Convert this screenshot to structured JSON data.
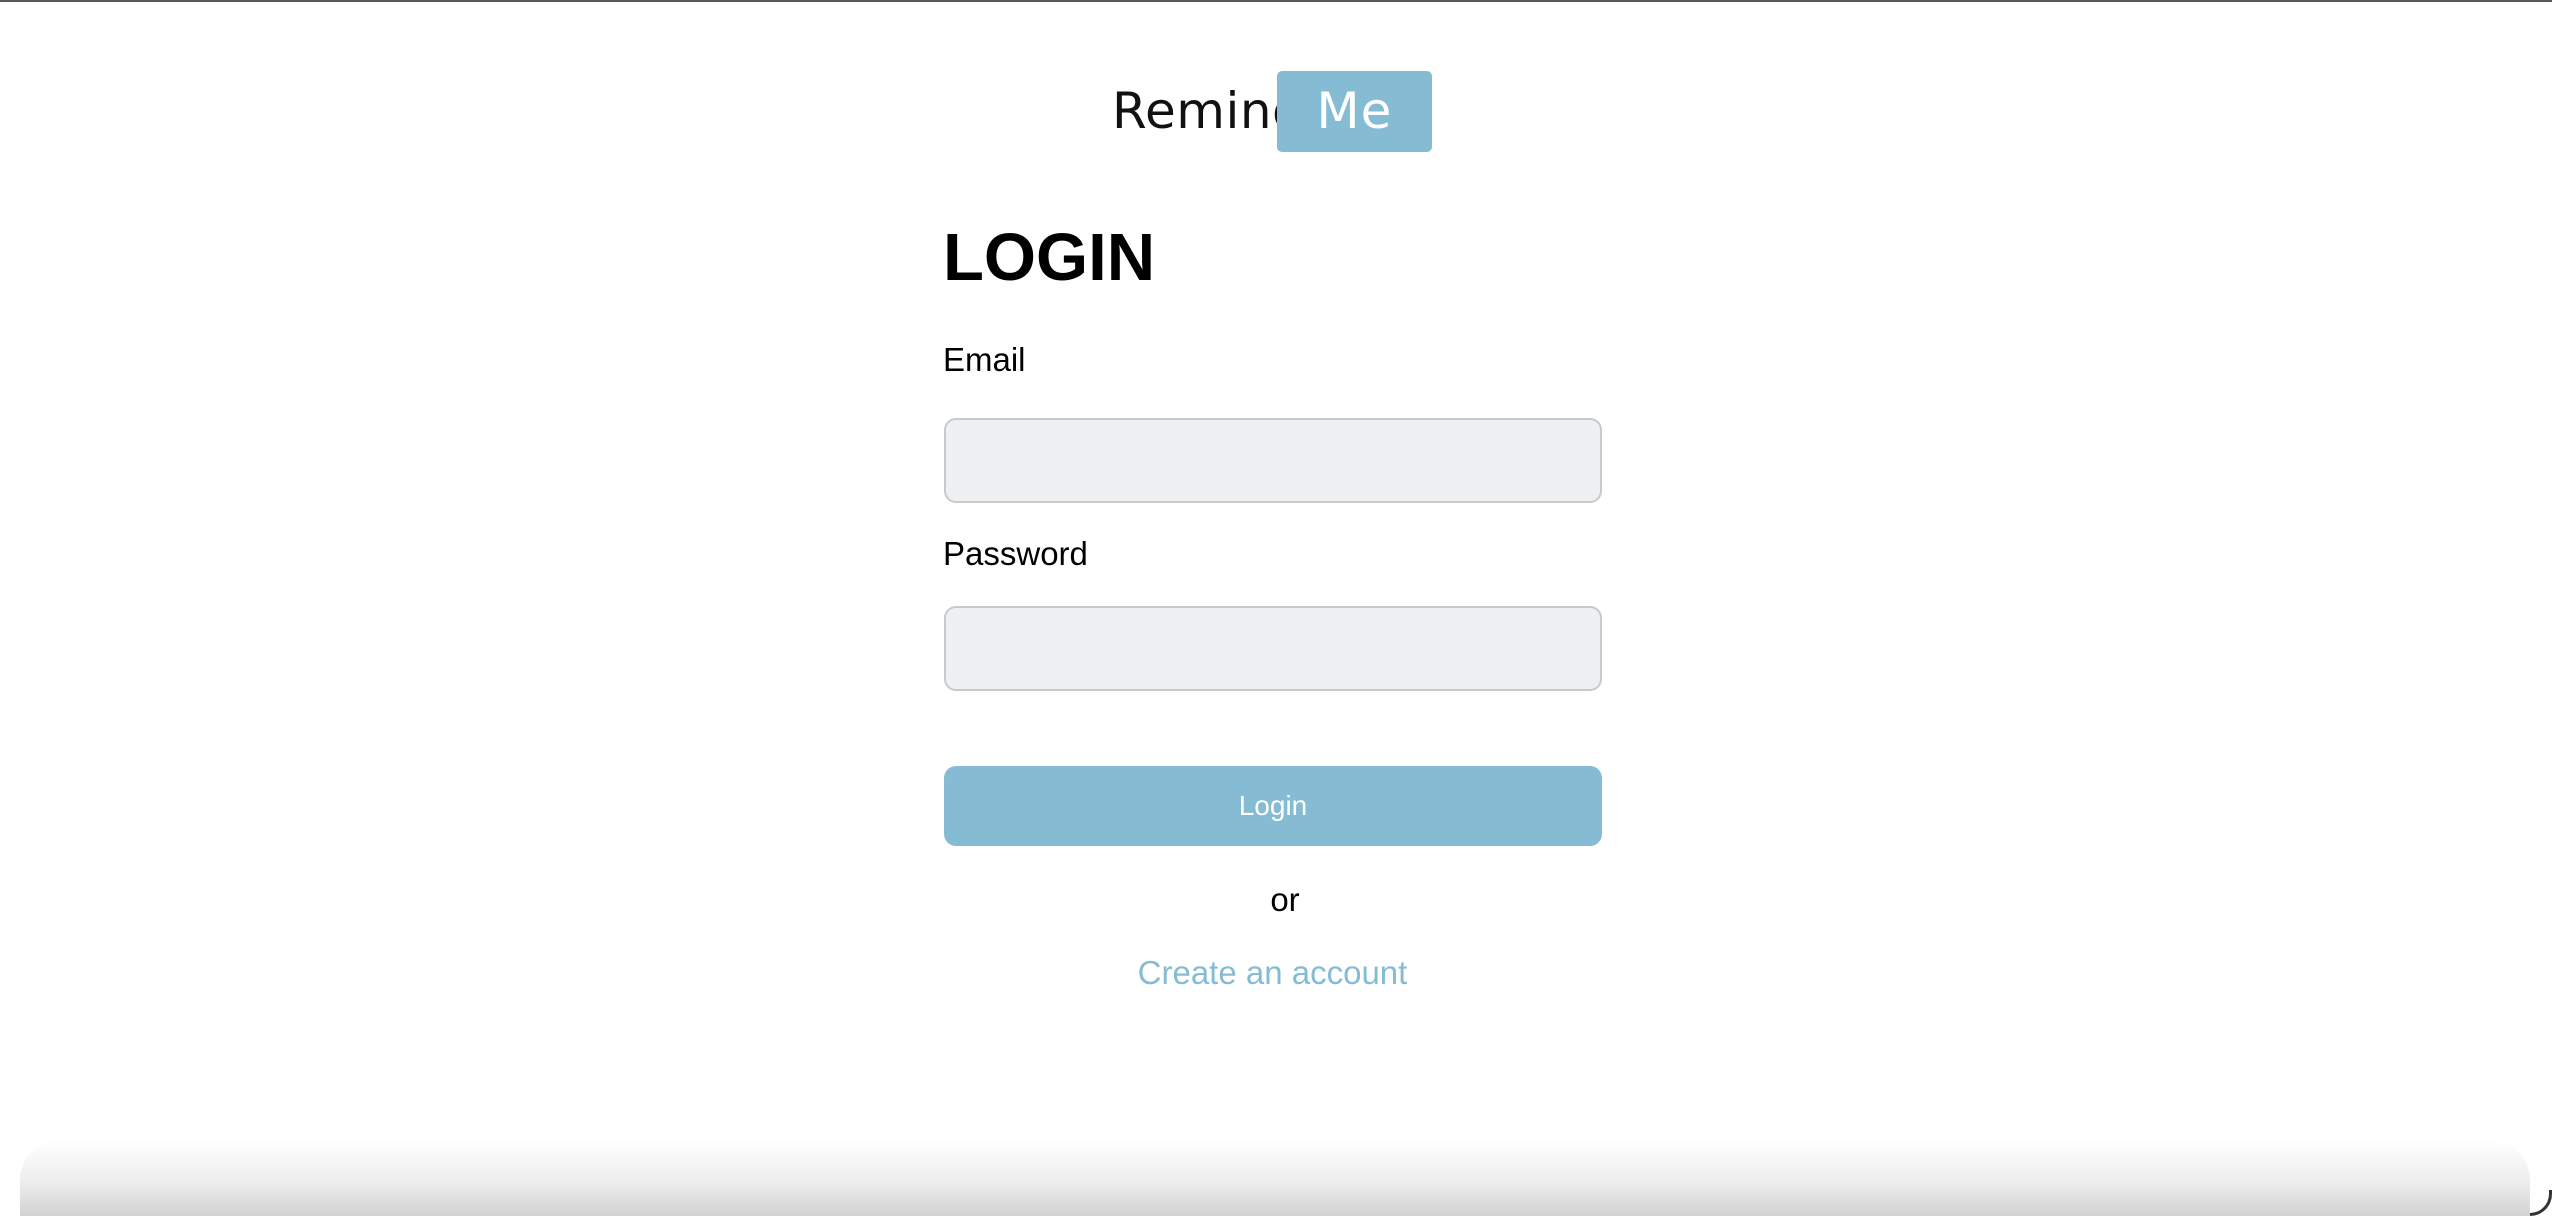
{
  "brand": {
    "word": "Remind",
    "badge": "Me",
    "accent_color": "#86bcd3"
  },
  "form": {
    "title": "LOGIN",
    "email_label": "Email",
    "email_value": "",
    "password_label": "Password",
    "password_value": "",
    "submit_label": "Login",
    "separator": "or",
    "create_account_label": "Create an account"
  }
}
